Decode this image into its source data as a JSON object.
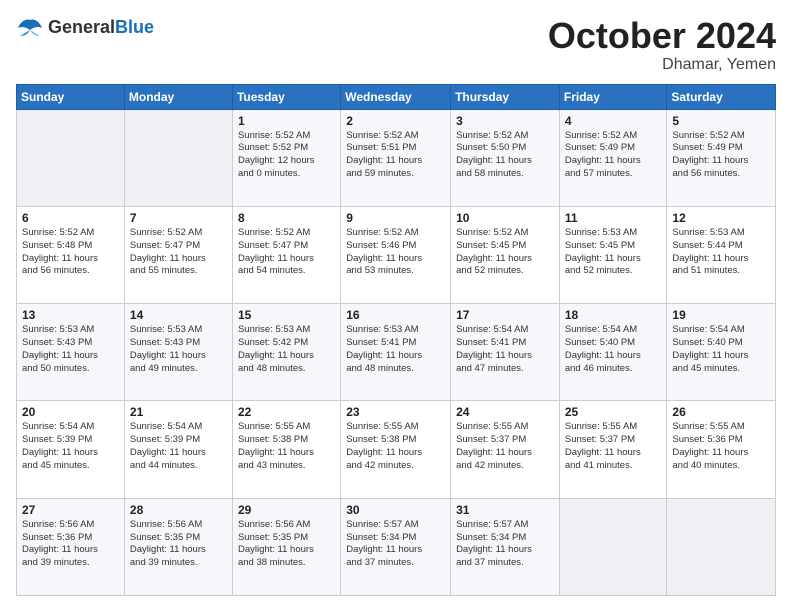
{
  "header": {
    "logo_general": "General",
    "logo_blue": "Blue",
    "month": "October 2024",
    "location": "Dhamar, Yemen"
  },
  "weekdays": [
    "Sunday",
    "Monday",
    "Tuesday",
    "Wednesday",
    "Thursday",
    "Friday",
    "Saturday"
  ],
  "weeks": [
    [
      {
        "day": "",
        "info": ""
      },
      {
        "day": "",
        "info": ""
      },
      {
        "day": "1",
        "info": "Sunrise: 5:52 AM\nSunset: 5:52 PM\nDaylight: 12 hours\nand 0 minutes."
      },
      {
        "day": "2",
        "info": "Sunrise: 5:52 AM\nSunset: 5:51 PM\nDaylight: 11 hours\nand 59 minutes."
      },
      {
        "day": "3",
        "info": "Sunrise: 5:52 AM\nSunset: 5:50 PM\nDaylight: 11 hours\nand 58 minutes."
      },
      {
        "day": "4",
        "info": "Sunrise: 5:52 AM\nSunset: 5:49 PM\nDaylight: 11 hours\nand 57 minutes."
      },
      {
        "day": "5",
        "info": "Sunrise: 5:52 AM\nSunset: 5:49 PM\nDaylight: 11 hours\nand 56 minutes."
      }
    ],
    [
      {
        "day": "6",
        "info": "Sunrise: 5:52 AM\nSunset: 5:48 PM\nDaylight: 11 hours\nand 56 minutes."
      },
      {
        "day": "7",
        "info": "Sunrise: 5:52 AM\nSunset: 5:47 PM\nDaylight: 11 hours\nand 55 minutes."
      },
      {
        "day": "8",
        "info": "Sunrise: 5:52 AM\nSunset: 5:47 PM\nDaylight: 11 hours\nand 54 minutes."
      },
      {
        "day": "9",
        "info": "Sunrise: 5:52 AM\nSunset: 5:46 PM\nDaylight: 11 hours\nand 53 minutes."
      },
      {
        "day": "10",
        "info": "Sunrise: 5:52 AM\nSunset: 5:45 PM\nDaylight: 11 hours\nand 52 minutes."
      },
      {
        "day": "11",
        "info": "Sunrise: 5:53 AM\nSunset: 5:45 PM\nDaylight: 11 hours\nand 52 minutes."
      },
      {
        "day": "12",
        "info": "Sunrise: 5:53 AM\nSunset: 5:44 PM\nDaylight: 11 hours\nand 51 minutes."
      }
    ],
    [
      {
        "day": "13",
        "info": "Sunrise: 5:53 AM\nSunset: 5:43 PM\nDaylight: 11 hours\nand 50 minutes."
      },
      {
        "day": "14",
        "info": "Sunrise: 5:53 AM\nSunset: 5:43 PM\nDaylight: 11 hours\nand 49 minutes."
      },
      {
        "day": "15",
        "info": "Sunrise: 5:53 AM\nSunset: 5:42 PM\nDaylight: 11 hours\nand 48 minutes."
      },
      {
        "day": "16",
        "info": "Sunrise: 5:53 AM\nSunset: 5:41 PM\nDaylight: 11 hours\nand 48 minutes."
      },
      {
        "day": "17",
        "info": "Sunrise: 5:54 AM\nSunset: 5:41 PM\nDaylight: 11 hours\nand 47 minutes."
      },
      {
        "day": "18",
        "info": "Sunrise: 5:54 AM\nSunset: 5:40 PM\nDaylight: 11 hours\nand 46 minutes."
      },
      {
        "day": "19",
        "info": "Sunrise: 5:54 AM\nSunset: 5:40 PM\nDaylight: 11 hours\nand 45 minutes."
      }
    ],
    [
      {
        "day": "20",
        "info": "Sunrise: 5:54 AM\nSunset: 5:39 PM\nDaylight: 11 hours\nand 45 minutes."
      },
      {
        "day": "21",
        "info": "Sunrise: 5:54 AM\nSunset: 5:39 PM\nDaylight: 11 hours\nand 44 minutes."
      },
      {
        "day": "22",
        "info": "Sunrise: 5:55 AM\nSunset: 5:38 PM\nDaylight: 11 hours\nand 43 minutes."
      },
      {
        "day": "23",
        "info": "Sunrise: 5:55 AM\nSunset: 5:38 PM\nDaylight: 11 hours\nand 42 minutes."
      },
      {
        "day": "24",
        "info": "Sunrise: 5:55 AM\nSunset: 5:37 PM\nDaylight: 11 hours\nand 42 minutes."
      },
      {
        "day": "25",
        "info": "Sunrise: 5:55 AM\nSunset: 5:37 PM\nDaylight: 11 hours\nand 41 minutes."
      },
      {
        "day": "26",
        "info": "Sunrise: 5:55 AM\nSunset: 5:36 PM\nDaylight: 11 hours\nand 40 minutes."
      }
    ],
    [
      {
        "day": "27",
        "info": "Sunrise: 5:56 AM\nSunset: 5:36 PM\nDaylight: 11 hours\nand 39 minutes."
      },
      {
        "day": "28",
        "info": "Sunrise: 5:56 AM\nSunset: 5:35 PM\nDaylight: 11 hours\nand 39 minutes."
      },
      {
        "day": "29",
        "info": "Sunrise: 5:56 AM\nSunset: 5:35 PM\nDaylight: 11 hours\nand 38 minutes."
      },
      {
        "day": "30",
        "info": "Sunrise: 5:57 AM\nSunset: 5:34 PM\nDaylight: 11 hours\nand 37 minutes."
      },
      {
        "day": "31",
        "info": "Sunrise: 5:57 AM\nSunset: 5:34 PM\nDaylight: 11 hours\nand 37 minutes."
      },
      {
        "day": "",
        "info": ""
      },
      {
        "day": "",
        "info": ""
      }
    ]
  ]
}
